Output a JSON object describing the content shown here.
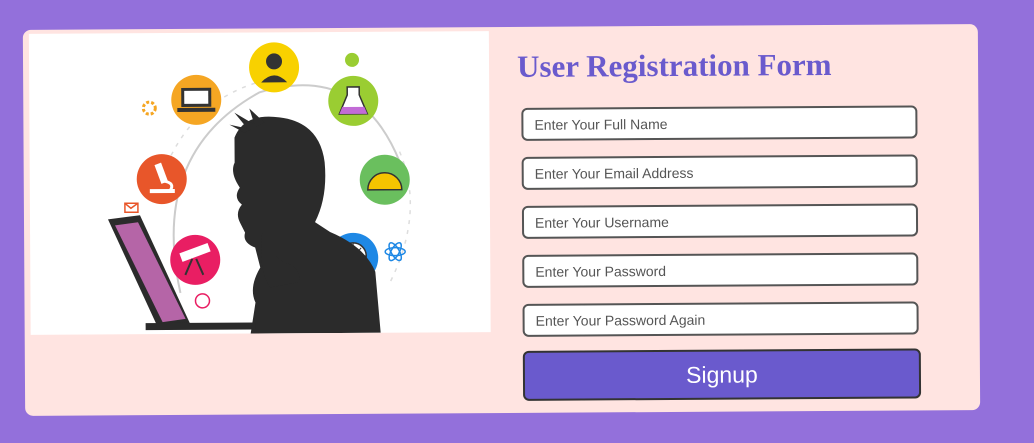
{
  "form": {
    "title": "User Registration Form",
    "fields": [
      {
        "placeholder": "Enter Your Full Name",
        "value": ""
      },
      {
        "placeholder": "Enter Your Email Address",
        "value": ""
      },
      {
        "placeholder": "Enter Your Username",
        "value": ""
      },
      {
        "placeholder": "Enter Your Password",
        "value": ""
      },
      {
        "placeholder": "Enter Your Password Again",
        "value": ""
      }
    ],
    "submit_label": "Signup"
  },
  "illustration": {
    "icons": [
      "laptop-icon",
      "user-avatar-icon",
      "flask-icon",
      "protractor-icon",
      "globe-icon",
      "telescope-icon",
      "microscope-icon",
      "gear-icon",
      "chat-icon",
      "atom-icon",
      "mail-icon",
      "basketball-icon"
    ]
  },
  "colors": {
    "page_background": "#9370db",
    "card_background": "#ffe4e1",
    "accent": "#6a5acd"
  }
}
